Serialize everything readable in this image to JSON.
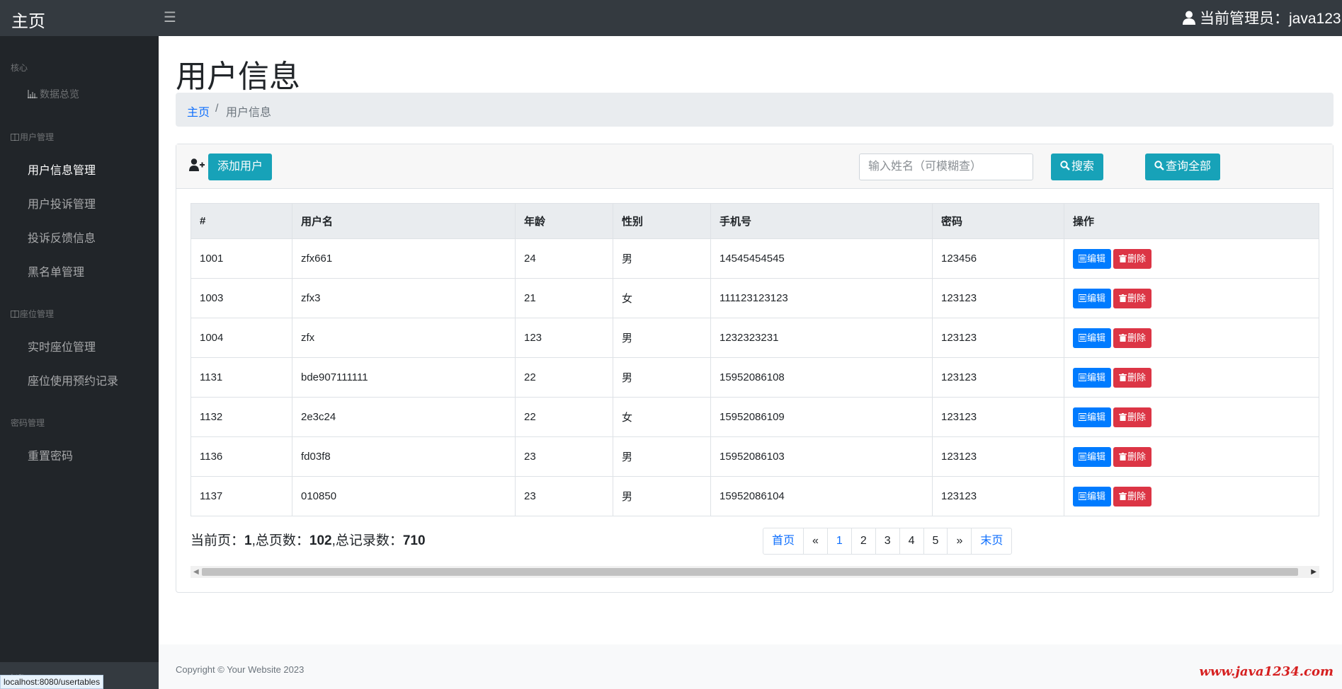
{
  "header": {
    "brand": "主页",
    "menu_icon": "☰",
    "admin_label": "当前管理员：",
    "admin_name": "java123"
  },
  "sidebar": {
    "sections": [
      {
        "heading": "核心"
      },
      {
        "heading": "用户管理"
      },
      {
        "heading": "座位管理"
      },
      {
        "heading": "密码管理"
      }
    ],
    "overview": "数据总览",
    "items": [
      {
        "label": "用户信息管理"
      },
      {
        "label": "用户投诉管理"
      },
      {
        "label": "投诉反馈信息"
      },
      {
        "label": "黑名单管理"
      },
      {
        "label": "实时座位管理"
      },
      {
        "label": "座位使用预约记录"
      },
      {
        "label": "重置密码"
      }
    ],
    "footer_text": "欢迎: java1234",
    "status_url": "localhost:8080/usertables"
  },
  "page": {
    "title": "用户信息",
    "breadcrumb_home": "主页",
    "breadcrumb_sep": "/",
    "breadcrumb_current": "用户信息"
  },
  "toolbar": {
    "add_label": "添加用户",
    "search_placeholder": "输入姓名（可模糊查）",
    "search_label": "搜索",
    "all_label": "查询全部"
  },
  "table": {
    "headers": [
      "#",
      "用户名",
      "年龄",
      "性别",
      "手机号",
      "密码",
      "操作"
    ],
    "edit_label": "编辑",
    "delete_label": "删除",
    "rows": [
      {
        "id": "1001",
        "username": "zfx661",
        "age": "24",
        "gender": "男",
        "phone": "14545454545",
        "password": "123456"
      },
      {
        "id": "1003",
        "username": "zfx3",
        "age": "21",
        "gender": "女",
        "phone": "111123123123",
        "password": "123123"
      },
      {
        "id": "1004",
        "username": "zfx",
        "age": "123",
        "gender": "男",
        "phone": "1232323231",
        "password": "123123"
      },
      {
        "id": "1131",
        "username": "bde907111111",
        "age": "22",
        "gender": "男",
        "phone": "15952086108",
        "password": "123123"
      },
      {
        "id": "1132",
        "username": "2e3c24",
        "age": "22",
        "gender": "女",
        "phone": "15952086109",
        "password": "123123"
      },
      {
        "id": "1136",
        "username": "fd03f8",
        "age": "23",
        "gender": "男",
        "phone": "15952086103",
        "password": "123123"
      },
      {
        "id": "1137",
        "username": "010850",
        "age": "23",
        "gender": "男",
        "phone": "15952086104",
        "password": "123123"
      }
    ]
  },
  "pagination": {
    "current_label": "当前页：",
    "current": "1",
    "total_pages_label": ",总页数：",
    "total_pages": "102",
    "total_records_label": ",总记录数：",
    "total_records": "710",
    "first": "首页",
    "prev": "«",
    "pages": [
      "1",
      "2",
      "3",
      "4",
      "5"
    ],
    "next": "»",
    "last": "末页"
  },
  "footer": {
    "copyright": "Copyright © Your Website 2023",
    "watermark": "www.java1234.com"
  },
  "colors": {
    "topbar": "#343a40",
    "sidebar": "#212529",
    "info": "#17a2b8",
    "primary": "#007bff",
    "danger": "#dc3545"
  }
}
